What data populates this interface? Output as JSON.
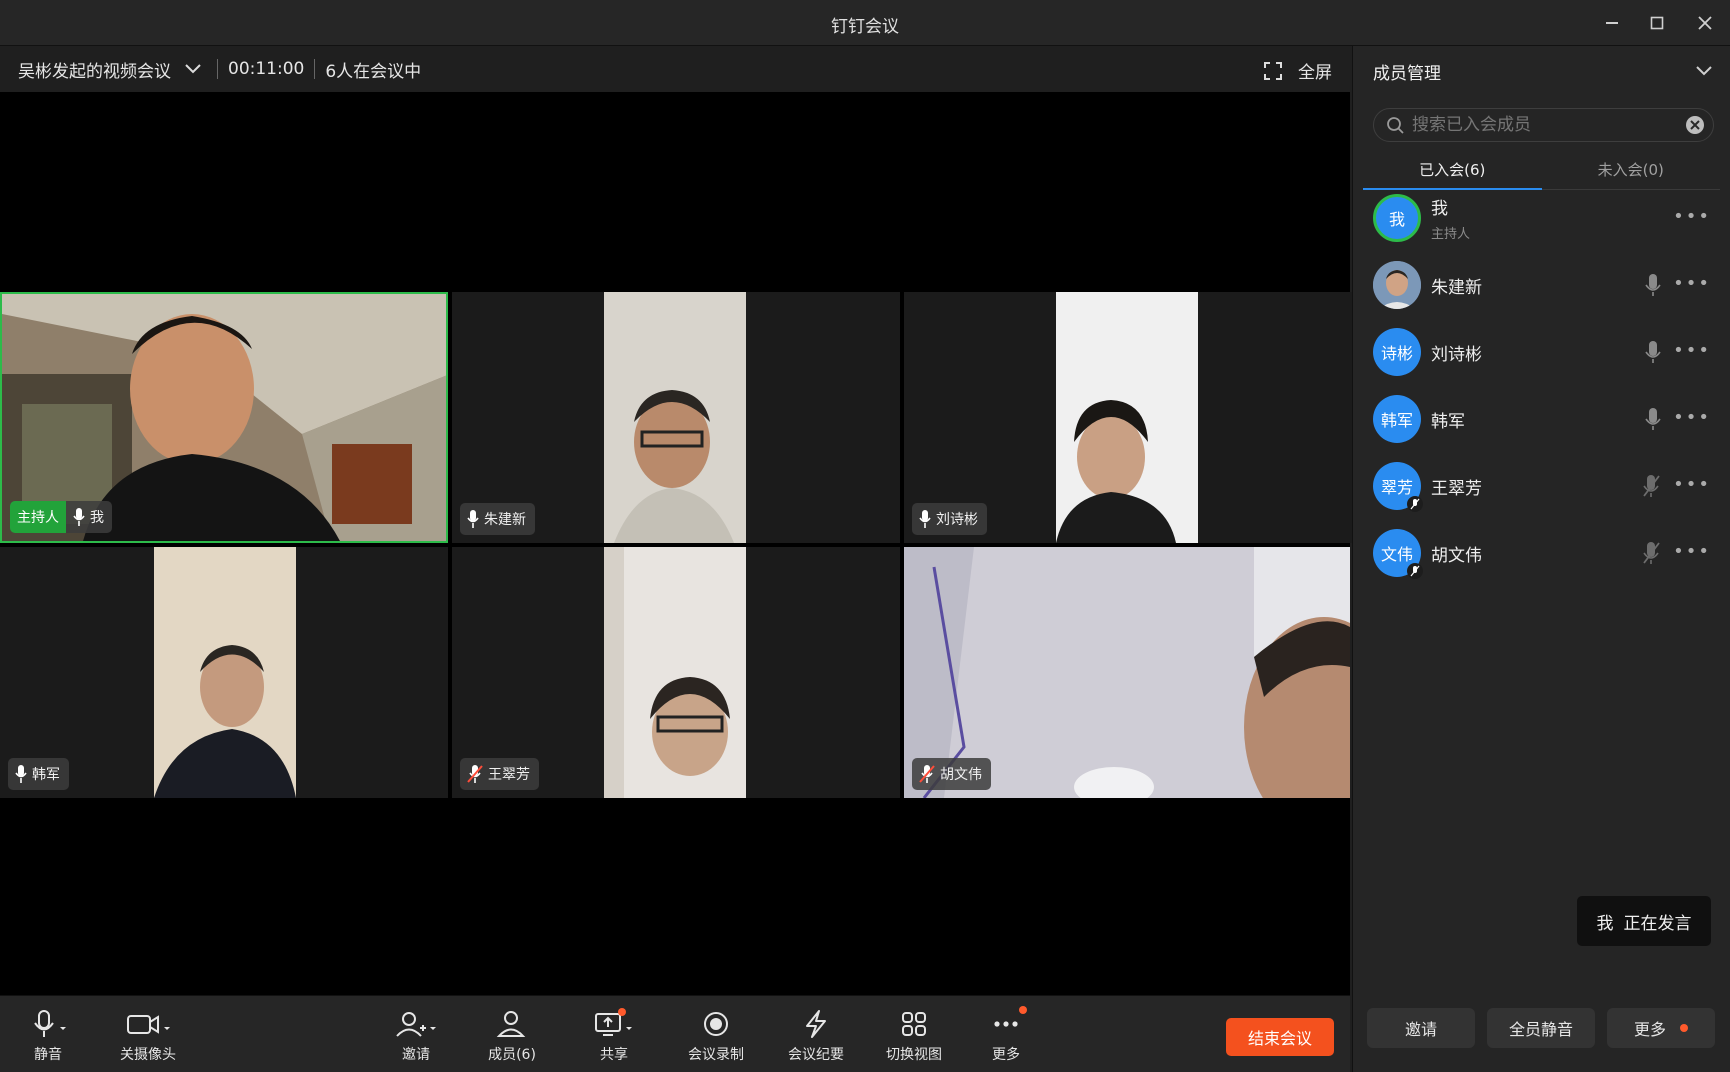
{
  "window": {
    "title": "钉钉会议"
  },
  "meeting": {
    "name": "吴彬发起的视频会议",
    "duration": "00:11:00",
    "participant_status": "6人在会议中",
    "fullscreen_label": "全屏"
  },
  "tiles": [
    {
      "name": "我",
      "host_label": "主持人",
      "muted": false
    },
    {
      "name": "朱建新",
      "muted": false
    },
    {
      "name": "刘诗彬",
      "muted": false
    },
    {
      "name": "韩军",
      "muted": false
    },
    {
      "name": "王翠芳",
      "muted": true
    },
    {
      "name": "胡文伟",
      "muted": true
    }
  ],
  "toolbar": {
    "mute": "静音",
    "camera": "关摄像头",
    "invite": "邀请",
    "members": "成员(6)",
    "share": "共享",
    "record": "会议录制",
    "minutes": "会议纪要",
    "switch_view": "切换视图",
    "more": "更多",
    "end": "结束会议"
  },
  "panel": {
    "title": "成员管理",
    "search_placeholder": "搜索已入会成员",
    "tabs": [
      "已入会(6)",
      "未入会(0)"
    ],
    "members": [
      {
        "avatar_text": "我",
        "name": "我",
        "role": "主持人"
      },
      {
        "avatar_text": "",
        "name": "朱建新"
      },
      {
        "avatar_text": "诗彬",
        "name": "刘诗彬"
      },
      {
        "avatar_text": "韩军",
        "name": "韩军"
      },
      {
        "avatar_text": "翠芳",
        "name": "王翠芳"
      },
      {
        "avatar_text": "文伟",
        "name": "胡文伟"
      }
    ],
    "speaking": {
      "who": "我",
      "text": "正在发言"
    },
    "buttons": {
      "invite": "邀请",
      "mute_all": "全员静音",
      "more": "更多"
    }
  },
  "colors": {
    "accent": "#2a8cf0",
    "host_green": "#22a33a",
    "end_red": "#f4511e",
    "notify_dot": "#ff5a2c"
  }
}
